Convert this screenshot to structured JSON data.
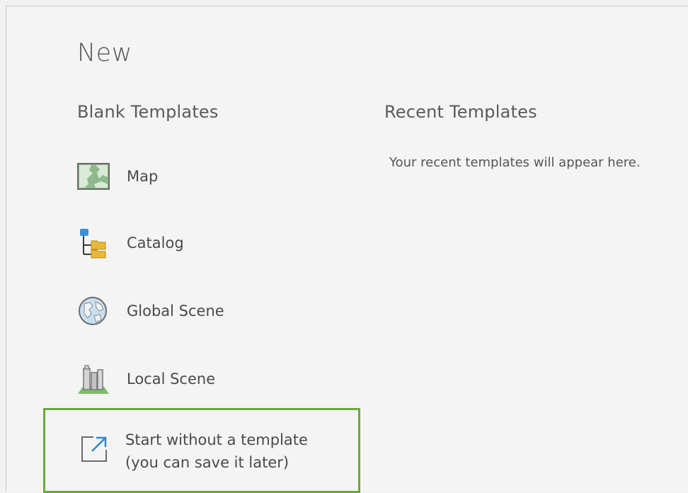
{
  "page": {
    "title": "New"
  },
  "blank_templates": {
    "heading": "Blank Templates",
    "items": [
      {
        "label": "Map",
        "icon": "map-icon"
      },
      {
        "label": "Catalog",
        "icon": "catalog-icon"
      },
      {
        "label": "Global Scene",
        "icon": "globe-icon"
      },
      {
        "label": "Local Scene",
        "icon": "local-scene-icon"
      }
    ]
  },
  "recent_templates": {
    "heading": "Recent Templates",
    "empty_message": "Your recent templates will appear here."
  },
  "start_without_template": {
    "line1": "Start without a template",
    "line2": "(you can save it later)",
    "icon": "open-external-icon",
    "highlight_color": "#6aa93a"
  }
}
